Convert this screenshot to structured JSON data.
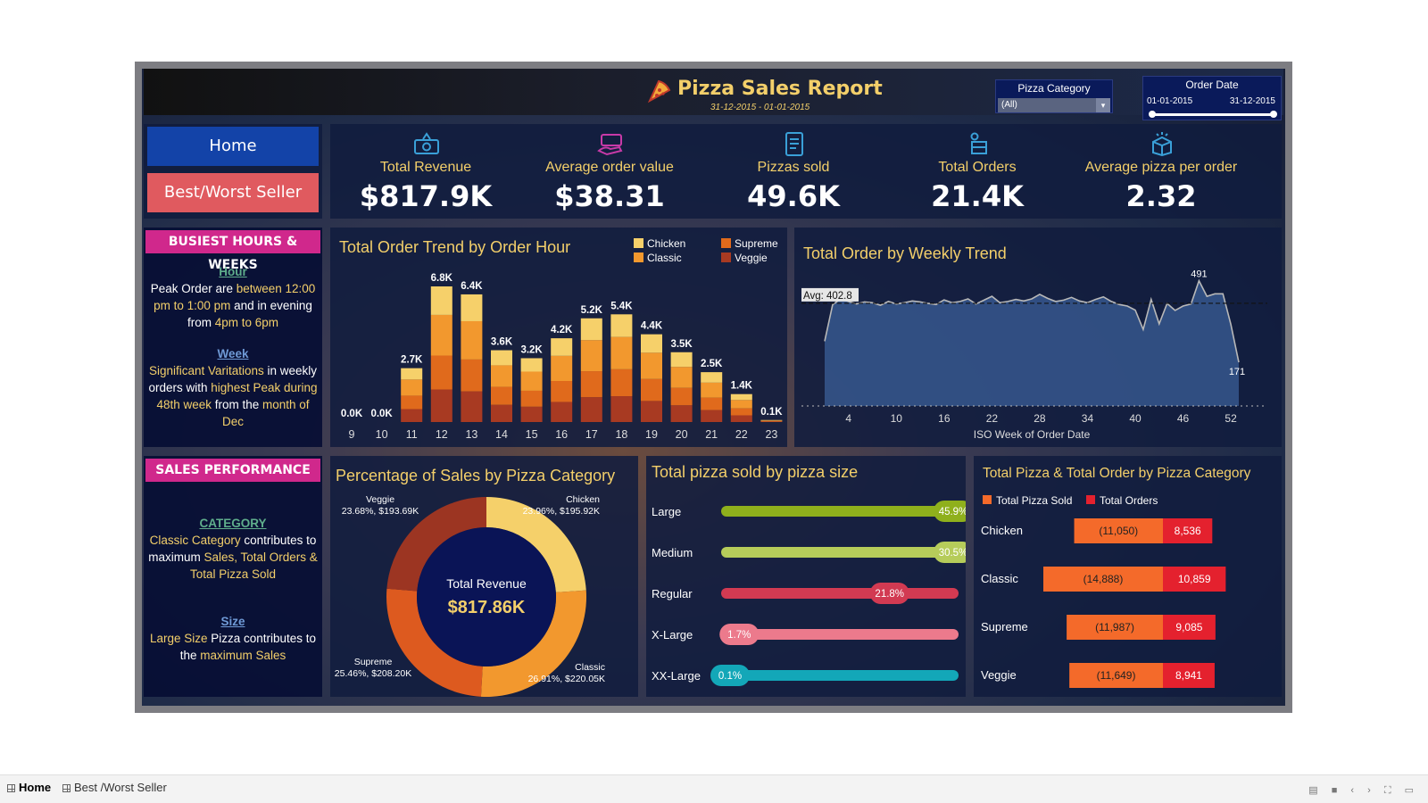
{
  "header": {
    "title": "Pizza Sales Report",
    "date_range": "31-12-2015 - 01-01-2015"
  },
  "filters": {
    "category_label": "Pizza Category",
    "category_value": "(All)",
    "date_label": "Order Date",
    "date_start": "01-01-2015",
    "date_end": "31-12-2015"
  },
  "nav": {
    "home": "Home",
    "best_worst": "Best/Worst Seller"
  },
  "kpis": [
    {
      "label": "Total Revenue",
      "value": "$817.9K",
      "icon": "money-icon"
    },
    {
      "label": "Average order value",
      "value": "$38.31",
      "icon": "cash-hand-icon"
    },
    {
      "label": "Pizzas sold",
      "value": "49.6K",
      "icon": "clipboard-icon"
    },
    {
      "label": "Total Orders",
      "value": "21.4K",
      "icon": "delivery-box-icon"
    },
    {
      "label": "Average pizza per order",
      "value": "2.32",
      "icon": "package-icon"
    }
  ],
  "busiest": {
    "header": "BUSIEST HOURS & WEEKS",
    "hour_title": "Hour",
    "hour_a": "Peak Order are ",
    "hour_b": "between 12:00 pm to 1:00 pm",
    "hour_c": " and in evening from ",
    "hour_d": "4pm to 6pm",
    "week_title": "Week",
    "week_a": "Significant Varitations",
    "week_b": " in weekly orders with ",
    "week_c": "highest Peak during 48th week",
    "week_d": " from the ",
    "week_e": "month of Dec"
  },
  "sales_perf": {
    "header": "SALES PERFORMANCE",
    "cat_title": "CATEGORY",
    "cat_a": "Classic Category",
    "cat_b": " contributes to maximum ",
    "cat_c": "Sales, Total Orders & Total Pizza Sold",
    "size_title": "Size",
    "size_a": "Large Size",
    "size_b": " Pizza contributes to the ",
    "size_c": "maximum Sales"
  },
  "chart_data": [
    {
      "type": "bar",
      "title": "Total Order Trend by Order Hour",
      "stacked": true,
      "categories": [
        "9",
        "10",
        "11",
        "12",
        "13",
        "14",
        "15",
        "16",
        "17",
        "18",
        "19",
        "20",
        "21",
        "22",
        "23"
      ],
      "totals_labels": [
        "0.0K",
        "0.0K",
        "2.7K",
        "6.8K",
        "6.4K",
        "3.6K",
        "3.2K",
        "4.2K",
        "5.2K",
        "5.4K",
        "4.4K",
        "3.5K",
        "2.5K",
        "1.4K",
        "0.1K"
      ],
      "totals": [
        0.0,
        0.0,
        2.7,
        6.8,
        6.4,
        3.6,
        3.2,
        4.2,
        5.2,
        5.4,
        4.4,
        3.5,
        2.5,
        1.4,
        0.1
      ],
      "series": [
        {
          "name": "Veggie",
          "color": "#a83a22",
          "share": 0.24
        },
        {
          "name": "Supreme",
          "color": "#e06a1c",
          "share": 0.25
        },
        {
          "name": "Classic",
          "color": "#f2982e",
          "share": 0.3
        },
        {
          "name": "Chicken",
          "color": "#f6d06a",
          "share": 0.21
        }
      ],
      "legend": [
        "Chicken",
        "Supreme",
        "Classic",
        "Veggie"
      ]
    },
    {
      "type": "area",
      "title": "Total Order by Weekly Trend",
      "xlabel": "ISO Week of Order Date",
      "xticks": [
        4,
        10,
        16,
        22,
        28,
        34,
        40,
        46,
        52
      ],
      "ylim": [
        0,
        560
      ],
      "avg": 402.8,
      "avg_label": "Avg: 402.8",
      "max_label": "491",
      "min_label": "171",
      "x": [
        1,
        2,
        3,
        4,
        5,
        6,
        7,
        8,
        9,
        10,
        11,
        12,
        13,
        14,
        15,
        16,
        17,
        18,
        19,
        20,
        21,
        22,
        23,
        24,
        25,
        26,
        27,
        28,
        29,
        30,
        31,
        32,
        33,
        34,
        35,
        36,
        37,
        38,
        39,
        40,
        41,
        42,
        43,
        44,
        45,
        46,
        47,
        48,
        49,
        50,
        51,
        52,
        53
      ],
      "values": [
        254,
        397,
        420,
        410,
        400,
        408,
        405,
        395,
        410,
        400,
        405,
        412,
        408,
        402,
        398,
        416,
        405,
        410,
        420,
        400,
        415,
        430,
        405,
        410,
        418,
        412,
        420,
        438,
        422,
        410,
        415,
        426,
        412,
        405,
        418,
        428,
        410,
        398,
        392,
        376,
        300,
        418,
        322,
        402,
        375,
        392,
        400,
        491,
        430,
        440,
        440,
        320,
        171
      ]
    },
    {
      "type": "pie",
      "title": "Percentage of Sales by Pizza Category",
      "center_label": "Total Revenue",
      "center_value": "$817.86K",
      "slices": [
        {
          "name": "Chicken",
          "pct": 23.96,
          "value": "$195.92K",
          "label": "23.96%, $195.92K",
          "color": "#f5d06a"
        },
        {
          "name": "Classic",
          "pct": 26.91,
          "value": "$220.05K",
          "label": "26.91%, $220.05K",
          "color": "#f2982e"
        },
        {
          "name": "Supreme",
          "pct": 25.46,
          "value": "$208.20K",
          "label": "25.46%, $208.20K",
          "color": "#dd5a1f"
        },
        {
          "name": "Veggie",
          "pct": 23.68,
          "value": "$193.69K",
          "label": "23.68%, $193.69K",
          "color": "#9c3522"
        }
      ]
    },
    {
      "type": "bar",
      "title": "Total pizza sold by pizza size",
      "categories": [
        "Large",
        "Medium",
        "Regular",
        "X-Large",
        "XX-Large"
      ],
      "values": [
        45.9,
        30.5,
        21.8,
        1.7,
        0.1
      ],
      "labels": [
        "45.9%",
        "30.5%",
        "21.8%",
        "1.7%",
        "0.1%"
      ],
      "colors": [
        "#8fb01c",
        "#b6cc5a",
        "#d23a52",
        "#ec7a8c",
        "#13a7b8"
      ]
    },
    {
      "type": "bar",
      "title": "Total Pizza & Total Order by Pizza Category",
      "categories": [
        "Chicken",
        "Classic",
        "Supreme",
        "Veggie"
      ],
      "series": [
        {
          "name": "Total Pizza Sold",
          "values": [
            11050,
            14888,
            11987,
            11649
          ],
          "labels": [
            "(11,050)",
            "(14,888)",
            "(11,987)",
            "(11,649)"
          ],
          "color": "#f46a2a"
        },
        {
          "name": "Total Orders",
          "values": [
            8536,
            10859,
            9085,
            8941
          ],
          "labels": [
            "8,536",
            "10,859",
            "9,085",
            "8,941"
          ],
          "color": "#e4212e"
        }
      ]
    }
  ],
  "tabs": {
    "home": "Home",
    "best_worst": "Best /Worst Seller"
  }
}
